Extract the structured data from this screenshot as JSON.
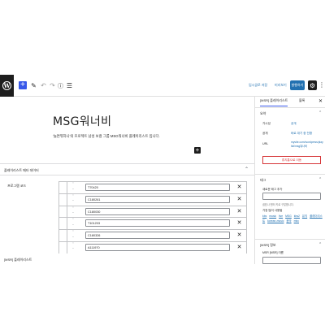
{
  "toolbar": {
    "logo_glyph": "W",
    "add_glyph": "+",
    "draft_label": "임시글로 저장",
    "preview_label": "미리보기",
    "publish_label": "발행하기",
    "settings_glyph": "⚙",
    "more_glyph": "⋮"
  },
  "post": {
    "title": "MSG워너비",
    "paragraph": "'놀면뭐하니'의 프로젝트 남성 보컬 그룹 MSG워너비 플레이리스트 입니다."
  },
  "meta_box": {
    "title": "플레이리스트 메타 데이터",
    "chevron": "⌃",
    "field_label": "프로그램 코드",
    "rows": [
      {
        "order_up": "⌃",
        "order_down": "⌄",
        "value": "T70420",
        "remove": "✕"
      },
      {
        "order_up": "⌃",
        "order_down": "⌄",
        "value": "C180261",
        "remove": "✕"
      },
      {
        "order_up": "⌃",
        "order_down": "⌄",
        "value": "C180030",
        "remove": "✕"
      },
      {
        "order_up": "⌃",
        "order_down": "⌄",
        "value": "T101203",
        "remove": "✕"
      },
      {
        "order_up": "⌃",
        "order_down": "⌄",
        "value": "C180326",
        "remove": "✕"
      },
      {
        "order_up": "⌃",
        "order_down": "⌄",
        "value": "A111970",
        "remove": "✕"
      }
    ],
    "bottom_label": "[MSR] 플레이리스트"
  },
  "sidebar": {
    "tab_active": "[MSR] 플레이리스트",
    "tab_block": "블록",
    "close_glyph": "✕",
    "summary": {
      "title": "요약",
      "visibility_key": "가시성",
      "visibility_val": "공개",
      "publish_key": "공개",
      "publish_val": "바로 대기 중 전환",
      "url_key": "URL",
      "url_val": "mysite.com/wordpress/playlist/msg워너비",
      "trash_label": "휴지통으로 이동"
    },
    "tags": {
      "title": "태그",
      "add_label": "새로운 태그 추가",
      "hint": "쉼표나 엔터 키로 구분합니다.",
      "popular_label": "가장 많이 사용됨",
      "cloud": [
        "kbs",
        "music",
        "live",
        "MSG",
        "kbs2",
        "뮤직",
        "플레이리스트",
        "korean-music",
        "음악",
        "mbc"
      ]
    },
    "msr": {
      "title": "[MSR] 정보",
      "subtitle": "MSR [MSR] 이름"
    },
    "chevron_up": "⌃"
  }
}
